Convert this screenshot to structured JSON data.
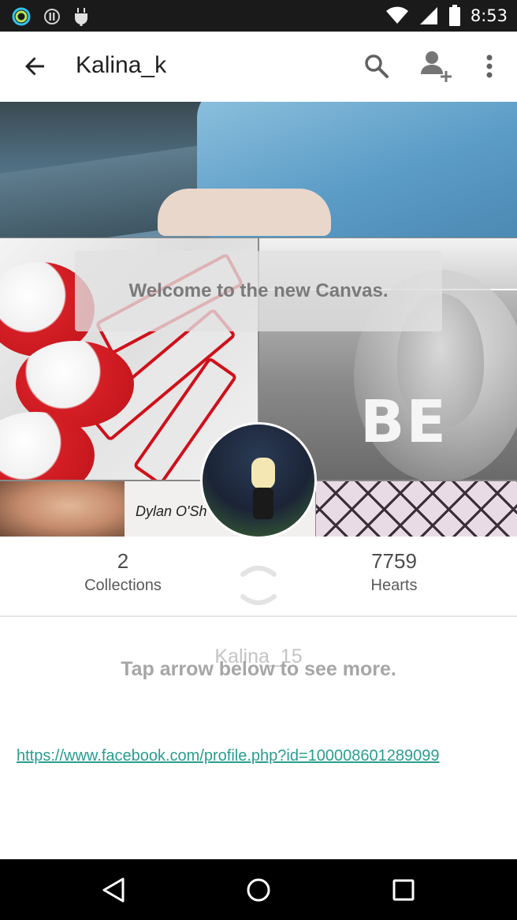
{
  "status_bar": {
    "time": "8:53",
    "left_icons": [
      "ring-notification-icon",
      "pause-circle-icon",
      "android-debug-icon"
    ],
    "right_icons": [
      "wifi-icon",
      "signal-icon",
      "battery-icon"
    ]
  },
  "app_bar": {
    "title": "Kalina_k",
    "actions": [
      "search-icon",
      "add-user-icon",
      "more-vert-icon"
    ]
  },
  "cover": {
    "banner_text": "Welcome to the new Canvas.",
    "tile_texts": {
      "be": "BE",
      "dylan_caption": "Dylan O'Sh"
    }
  },
  "stats": {
    "collections_count": "2",
    "collections_label": "Collections",
    "hearts_count": "7759",
    "hearts_label": "Hearts"
  },
  "bio": {
    "username": "Kalina_15",
    "hint": "Tap arrow below to see more.",
    "link": "https://www.facebook.com/profile.php?id=100008601289099"
  },
  "nav_bar": {
    "buttons": [
      "back-nav-icon",
      "home-nav-icon",
      "recents-nav-icon"
    ]
  }
}
